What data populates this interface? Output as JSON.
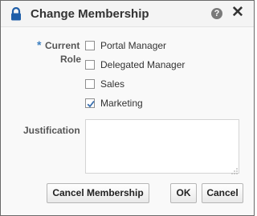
{
  "dialog": {
    "title": "Change Membership",
    "help_glyph": "?",
    "close_glyph": "✕"
  },
  "form": {
    "required_marker": "*",
    "role_label_line1": "Current",
    "role_label_line2": "Role",
    "roles": [
      {
        "label": "Portal Manager",
        "checked": false
      },
      {
        "label": "Delegated Manager",
        "checked": false
      },
      {
        "label": "Sales",
        "checked": false
      },
      {
        "label": "Marketing",
        "checked": true
      }
    ],
    "justification_label": "Justification",
    "justification_value": ""
  },
  "buttons": {
    "cancel_membership": "Cancel Membership",
    "ok": "OK",
    "cancel": "Cancel"
  },
  "colors": {
    "lock": "#1f5ea8",
    "required": "#3c7fc0",
    "checkmark": "#3a6fae"
  }
}
